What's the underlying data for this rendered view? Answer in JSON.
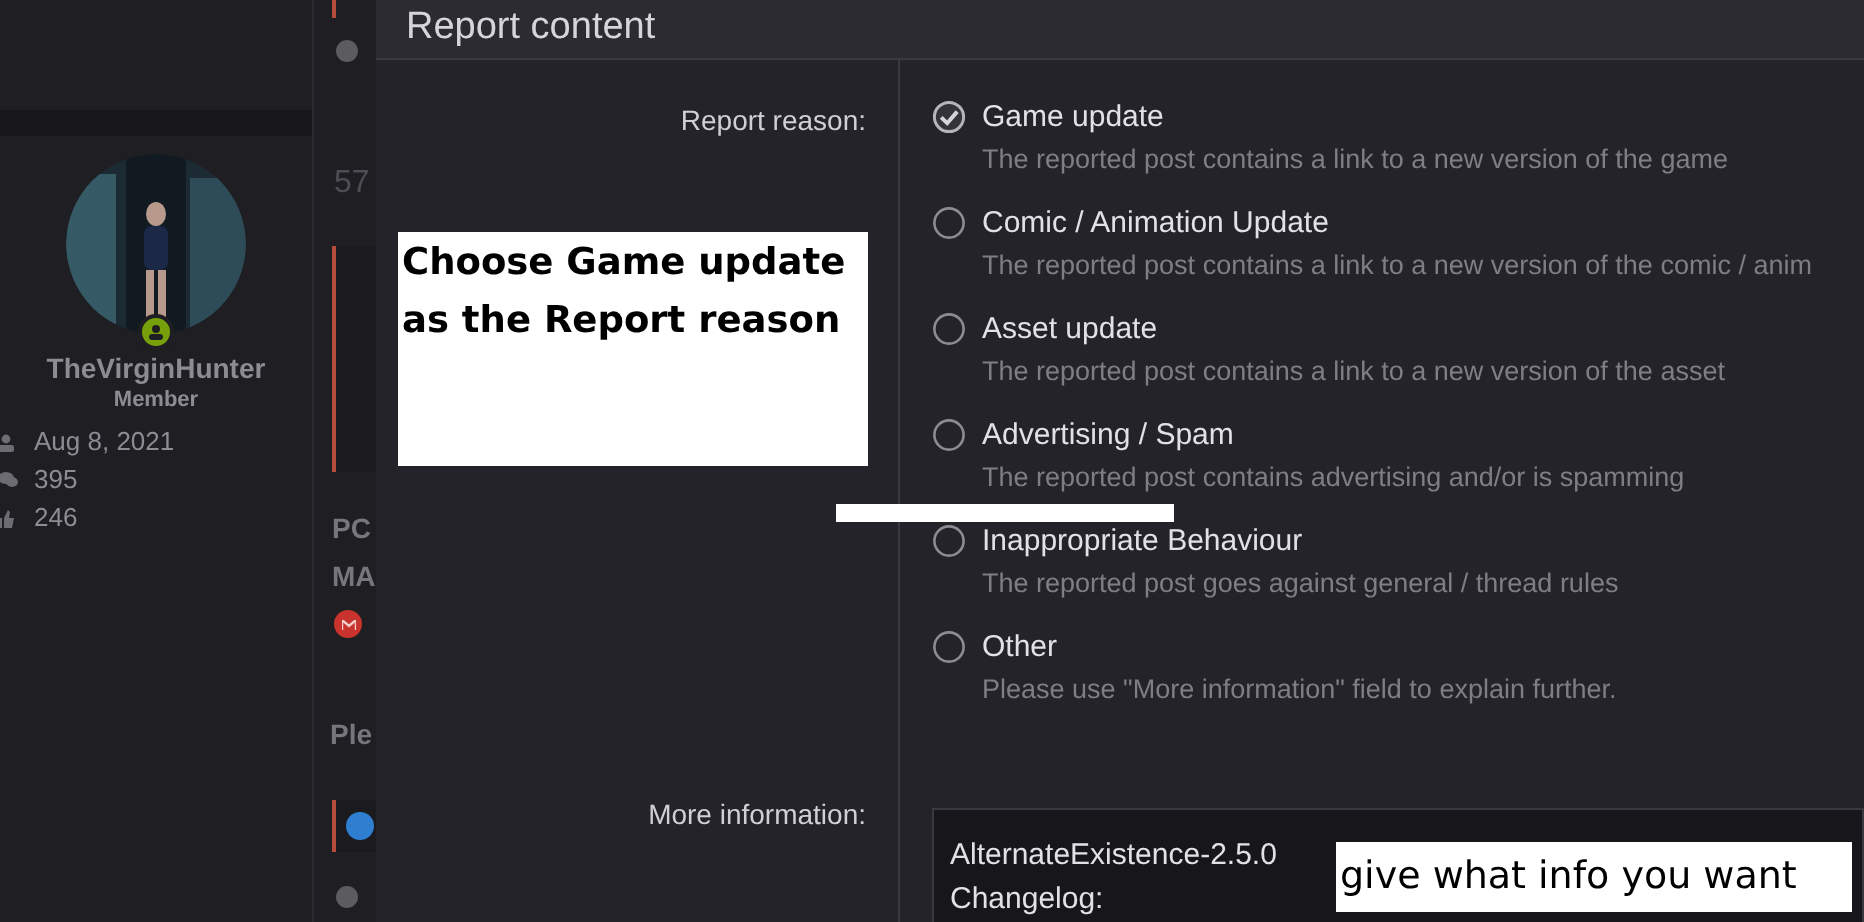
{
  "background_page": {
    "username": "TheVirginHunter",
    "role": "Member",
    "stats": [
      {
        "kind": "joined",
        "value": "Aug 8, 2021"
      },
      {
        "kind": "messages",
        "value": "395"
      },
      {
        "kind": "reactions",
        "value": "246"
      }
    ],
    "post_fragments": [
      "57",
      "PC",
      "MA",
      "Ple"
    ]
  },
  "dialog": {
    "title": "Report content",
    "reason_label": "Report reason:",
    "reasons": [
      {
        "label": "Game update",
        "description": "The reported post contains a link to a new version of the game",
        "selected": true
      },
      {
        "label": "Comic / Animation Update",
        "description": "The reported post contains a link to a new version of the comic / anim",
        "selected": false
      },
      {
        "label": "Asset update",
        "description": "The reported post contains a link to a new version of the asset",
        "selected": false
      },
      {
        "label": "Advertising / Spam",
        "description": "The reported post contains advertising and/or is spamming",
        "selected": false
      },
      {
        "label": "Inappropriate Behaviour",
        "description": "The reported post goes against general / thread rules",
        "selected": false
      },
      {
        "label": "Other",
        "description": "Please use \"More information\" field to explain further.",
        "selected": false
      }
    ],
    "more_info_label": "More information:",
    "more_info_value": "AlternateExistence-2.5.0\nChangelog:"
  },
  "annotations": [
    {
      "kind": "note",
      "text": "Choose Game update as the Report reason"
    },
    {
      "kind": "blank"
    },
    {
      "kind": "note",
      "text": "give what info you want"
    }
  ]
}
